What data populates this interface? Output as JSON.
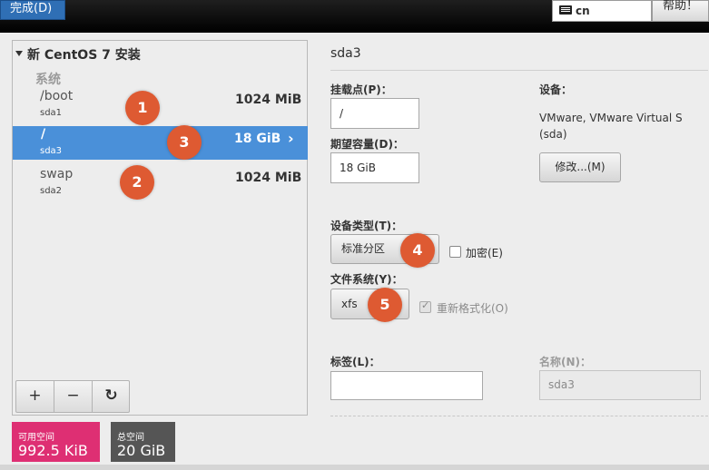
{
  "topbar": {
    "done_label": "完成(D)",
    "keyboard_layout": "cn",
    "help_label": "帮助！"
  },
  "tree": {
    "title": "新 CentOS 7 安装",
    "group_label": "系统",
    "rows": [
      {
        "mount": "/boot",
        "device": "sda1",
        "size": "1024 MiB",
        "selected": false
      },
      {
        "mount": "/",
        "device": "sda3",
        "size": "18 GiB",
        "selected": true
      },
      {
        "mount": "swap",
        "device": "sda2",
        "size": "1024 MiB",
        "selected": false
      }
    ]
  },
  "toolbar": {
    "add_label": "+",
    "remove_label": "−",
    "refresh_label": "↻"
  },
  "space": {
    "available_label": "可用空间",
    "available_value": "992.5 KiB",
    "total_label": "总空间",
    "total_value": "20 GiB",
    "available_color": "#de2f73",
    "total_color": "#555555"
  },
  "detail": {
    "title": "sda3",
    "mount_point_label": "挂载点(P)：",
    "mount_point_value": "/",
    "capacity_label": "期望容量(D)：",
    "capacity_value": "18 GiB",
    "device_label": "设备：",
    "device_line1": "VMware, VMware Virtual S",
    "device_line2": "(sda)",
    "modify_label": "修改...(M)",
    "device_type_label": "设备类型(T)：",
    "device_type_value": "标准分区",
    "encrypt_label": "加密(E)",
    "filesystem_label": "文件系统(Y)：",
    "filesystem_value": "xfs",
    "reformat_label": "重新格式化(O)",
    "tag_label": "标签(L)：",
    "tag_value": "",
    "name_label": "名称(N)：",
    "name_value": "sda3"
  },
  "annotations": [
    "1",
    "2",
    "3",
    "4",
    "5"
  ],
  "colors": {
    "selection": "#4a90d9",
    "badge": "#de5a32",
    "done_button": "#2f6fb5"
  }
}
